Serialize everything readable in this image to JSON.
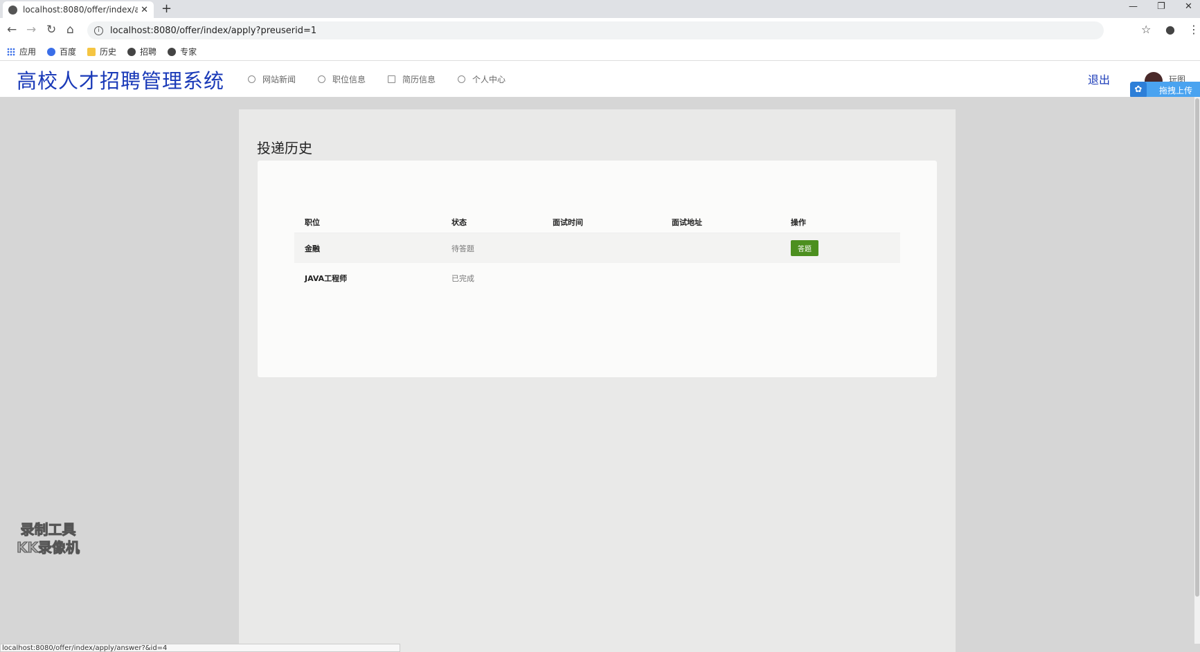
{
  "browser": {
    "tab_title": "localhost:8080/offer/index/ap",
    "new_tab": "+",
    "url": "localhost:8080/offer/index/apply?preuserid=1",
    "bookmarks": [
      {
        "label": "应用",
        "icon": "apps-icon"
      },
      {
        "label": "百度",
        "icon": "baidu-paw-icon"
      },
      {
        "label": "历史",
        "icon": "folder-icon"
      },
      {
        "label": "招聘",
        "icon": "globe-icon"
      },
      {
        "label": "专家",
        "icon": "globe-icon"
      }
    ],
    "status_url": "localhost:8080/offer/index/apply/answer?&id=4"
  },
  "site": {
    "title": "高校人才招聘管理系统",
    "nav": [
      {
        "label": "网站新闻",
        "icon": "chat-bubble-icon"
      },
      {
        "label": "职位信息",
        "icon": "chat-bubble-icon"
      },
      {
        "label": "简历信息",
        "icon": "document-icon"
      },
      {
        "label": "个人中心",
        "icon": "user-icon"
      }
    ],
    "logout": "退出",
    "username": "玩图",
    "upload_badge": "拖拽上传"
  },
  "main": {
    "heading": "投递历史",
    "table": {
      "headers": [
        "职位",
        "状态",
        "面试时间",
        "面试地址",
        "操作"
      ],
      "rows": [
        {
          "position": "金融",
          "status": "待答题",
          "time": "",
          "address": "",
          "action": "答题"
        },
        {
          "position": "JAVA工程师",
          "status": "已完成",
          "time": "",
          "address": "",
          "action": ""
        }
      ]
    }
  },
  "watermark": {
    "line1": "录制工具",
    "line2": "KK录像机"
  },
  "colors": {
    "brand": "#1a3ab8",
    "answer_button": "#4c8f1f"
  }
}
